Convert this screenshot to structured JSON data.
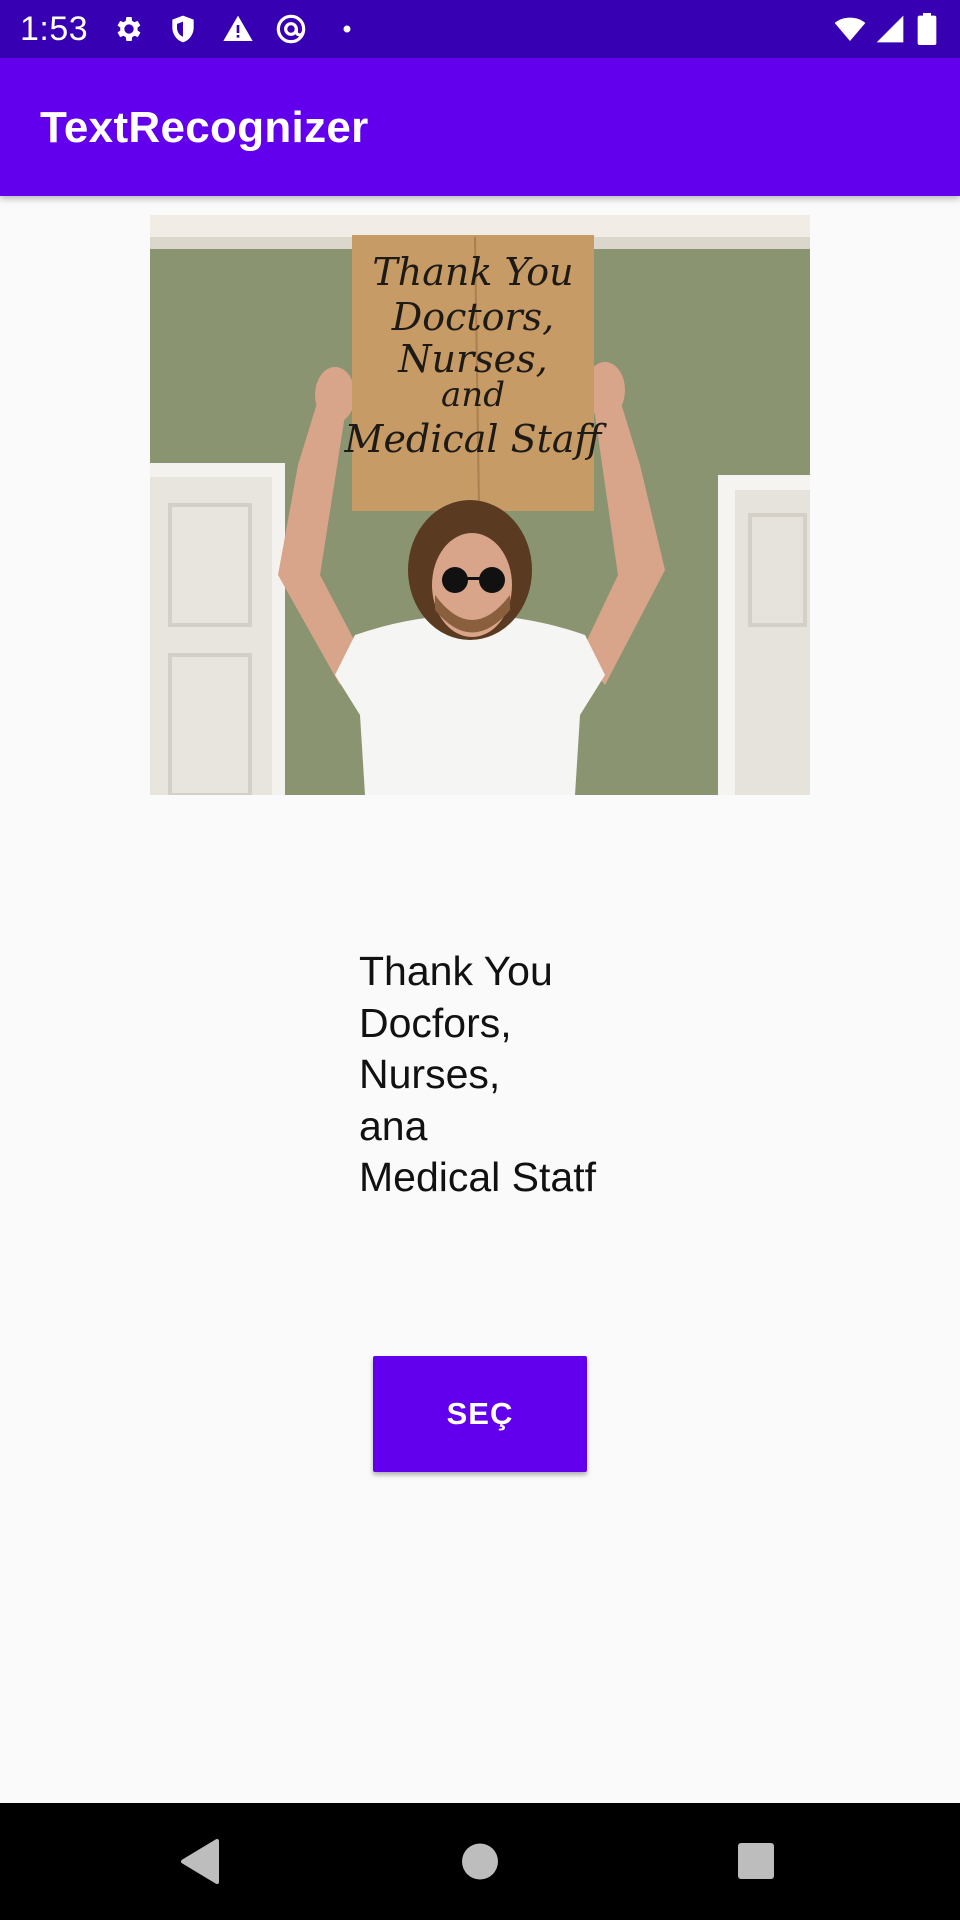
{
  "status_bar": {
    "time": "1:53",
    "left_icons": [
      "gear-icon",
      "shield-icon",
      "warning-icon",
      "at-sign-icon",
      "dot-icon"
    ],
    "right_icons": [
      "wifi-icon",
      "signal-icon",
      "battery-icon"
    ]
  },
  "app_bar": {
    "title": "TextRecognizer"
  },
  "photo": {
    "description_icon": "photo-image",
    "sign_lines": [
      "Thank You",
      "Doctors,",
      "Nurses,",
      "and",
      "Medical Staff"
    ]
  },
  "result": {
    "lines": [
      "Thank You",
      "Docfors,",
      "Nurses,",
      "ana",
      "Medical Statf"
    ]
  },
  "select_button": {
    "label": "SEÇ"
  },
  "colors": {
    "status_bar": "#3700b3",
    "app_bar": "#6200ee",
    "button": "#6200ee",
    "background": "#fafafa"
  },
  "nav_bar": {
    "icons": [
      "back-icon",
      "home-icon",
      "recents-icon"
    ]
  }
}
